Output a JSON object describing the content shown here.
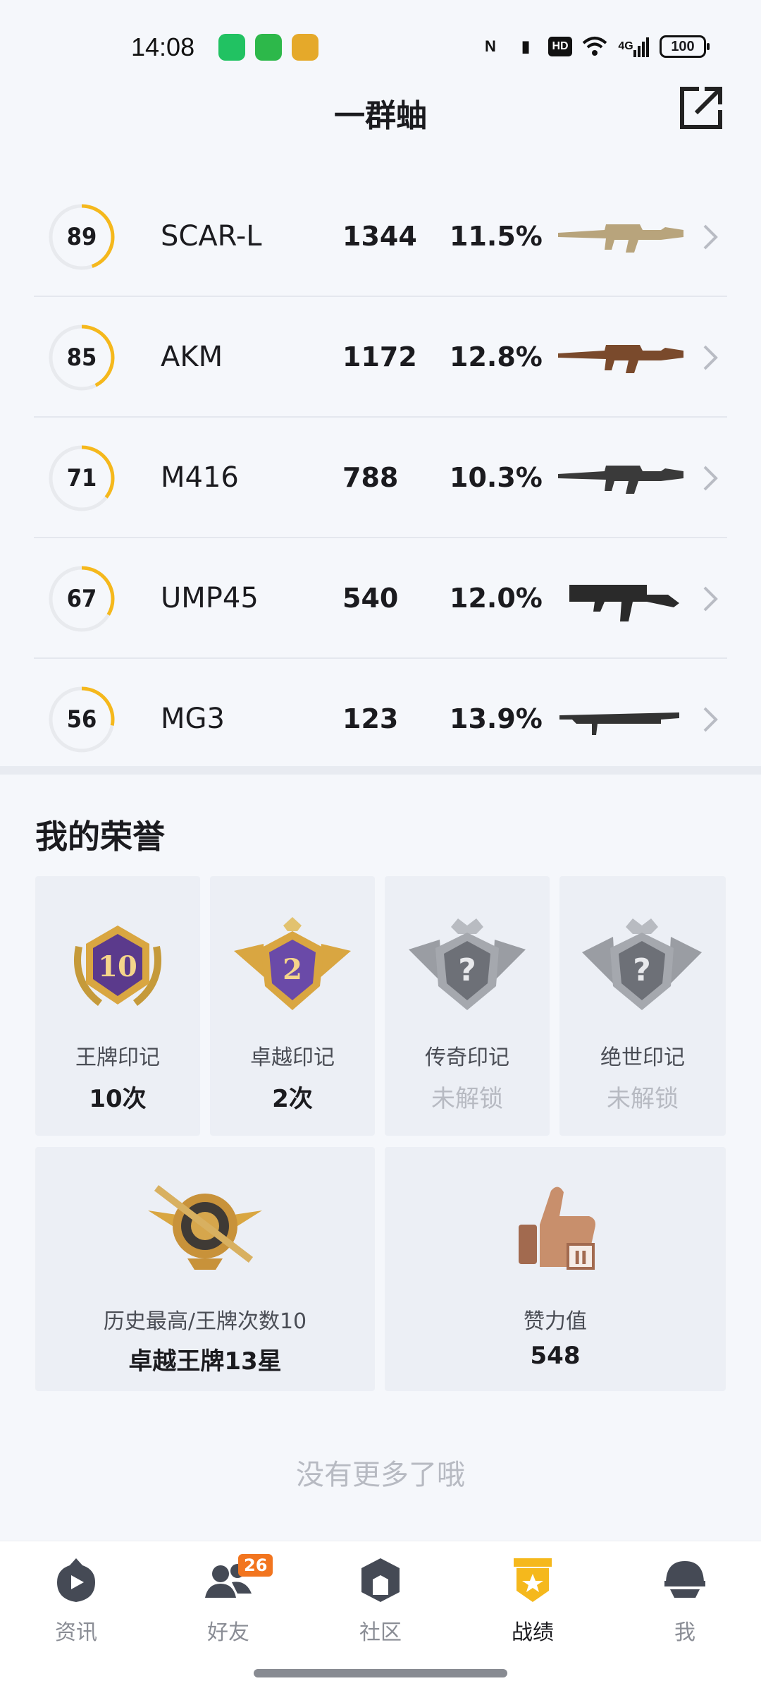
{
  "status_bar": {
    "time": "14:08",
    "battery": "100",
    "signal": "4G",
    "hd": "HD",
    "nfc": "N"
  },
  "header": {
    "title": "一群蚰"
  },
  "weapons": [
    {
      "rating": "89",
      "rating_value": 89,
      "name": "SCAR-L",
      "kills": "1344",
      "rate": "11.5%",
      "gun_color": "#b8a47c"
    },
    {
      "rating": "85",
      "rating_value": 85,
      "name": "AKM",
      "kills": "1172",
      "rate": "12.8%",
      "gun_color": "#7a4a2c"
    },
    {
      "rating": "71",
      "rating_value": 71,
      "name": "M416",
      "kills": "788",
      "rate": "10.3%",
      "gun_color": "#3a3a3a"
    },
    {
      "rating": "67",
      "rating_value": 67,
      "name": "UMP45",
      "kills": "540",
      "rate": "12.0%",
      "gun_color": "#2a2a2a"
    },
    {
      "rating": "56",
      "rating_value": 56,
      "name": "MG3",
      "kills": "123",
      "rate": "13.9%",
      "gun_color": "#333333"
    }
  ],
  "honors": {
    "title": "我的荣誉",
    "marks": [
      {
        "label": "王牌印记",
        "value": "10次",
        "locked": false,
        "badge_text": "10",
        "icon": "ace-mark-badge"
      },
      {
        "label": "卓越印记",
        "value": "2次",
        "locked": false,
        "badge_text": "2",
        "icon": "excellence-mark-badge"
      },
      {
        "label": "传奇印记",
        "value": "未解锁",
        "locked": true,
        "badge_text": "?",
        "icon": "legend-mark-badge"
      },
      {
        "label": "绝世印记",
        "value": "未解锁",
        "locked": true,
        "badge_text": "?",
        "icon": "peerless-mark-badge"
      }
    ],
    "history": {
      "label": "历史最高/王牌次数10",
      "value": "卓越王牌13星"
    },
    "likes": {
      "label": "赞力值",
      "value": "548"
    }
  },
  "footer_text": "没有更多了哦",
  "nav": [
    {
      "label": "资讯",
      "icon": "news-icon",
      "active": false
    },
    {
      "label": "好友",
      "icon": "friends-icon",
      "active": false,
      "badge": "26"
    },
    {
      "label": "社区",
      "icon": "community-icon",
      "active": false
    },
    {
      "label": "战绩",
      "icon": "record-icon",
      "active": true
    },
    {
      "label": "我",
      "icon": "profile-icon",
      "active": false
    }
  ],
  "colors": {
    "accent": "#f5b81c",
    "nav_active": "#f5b81c",
    "badge": "#f2751f"
  }
}
